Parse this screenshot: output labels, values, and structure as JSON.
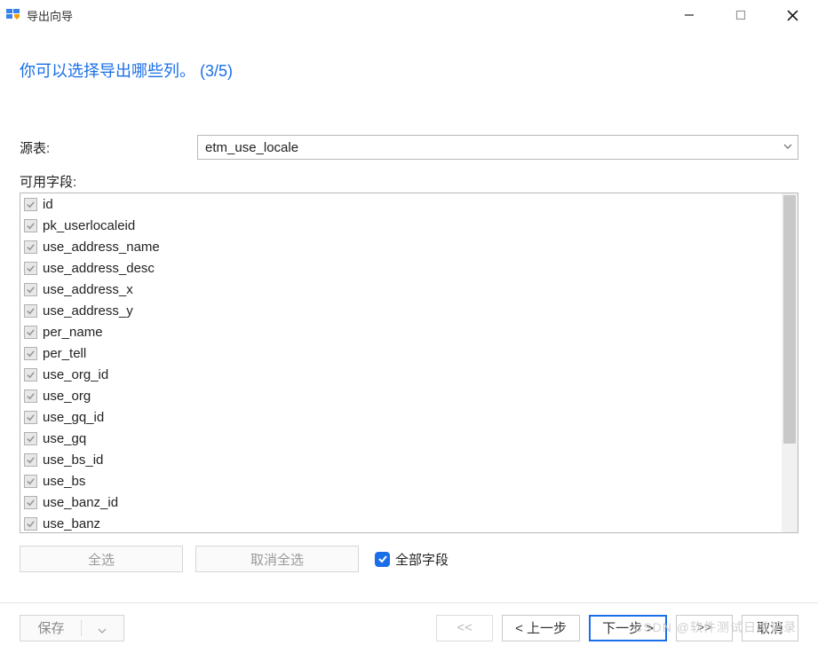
{
  "window": {
    "title": "导出向导"
  },
  "heading": "你可以选择导出哪些列。  (3/5)",
  "source": {
    "label": "源表:",
    "value": "etm_use_locale"
  },
  "fields_label": "可用字段:",
  "fields": [
    "id",
    "pk_userlocaleid",
    "use_address_name",
    "use_address_desc",
    "use_address_x",
    "use_address_y",
    "per_name",
    "per_tell",
    "use_org_id",
    "use_org",
    "use_gq_id",
    "use_gq",
    "use_bs_id",
    "use_bs",
    "use_banz_id",
    "use_banz"
  ],
  "buttons": {
    "select_all": "全选",
    "deselect_all": "取消全选",
    "all_fields": "全部字段"
  },
  "bottom": {
    "save": "保存",
    "first": "<<",
    "prev": "< 上一步",
    "next": "下一步 >",
    "last": ">>",
    "cancel": "取消"
  },
  "watermark": "CSDN @软件测试日常记录"
}
